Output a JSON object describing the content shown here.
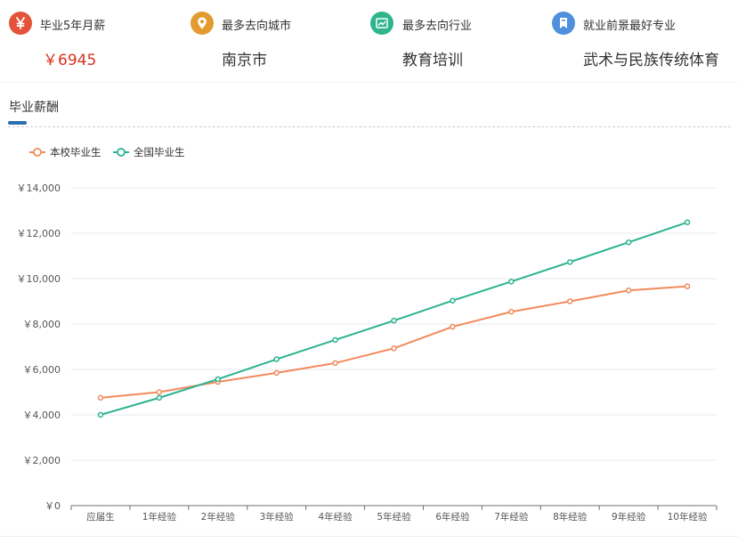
{
  "stats": [
    {
      "label": "毕业5年月薪",
      "value": "￥6945",
      "icon": "yen-icon",
      "color": "#e2533a",
      "value_color": "#d9331f"
    },
    {
      "label": "最多去向城市",
      "value": "南京市",
      "icon": "location-pin-icon",
      "color": "#e39a2f",
      "value_color": "#333333"
    },
    {
      "label": "最多去向行业",
      "value": "教育培训",
      "icon": "trend-chart-icon",
      "color": "#2fb58b",
      "value_color": "#333333"
    },
    {
      "label": "就业前景最好专业",
      "value": "武术与民族传统体育",
      "icon": "bookmark-icon",
      "color": "#4f8fdc",
      "value_color": "#333333"
    }
  ],
  "section": {
    "title": "毕业薪酬"
  },
  "chart_data": {
    "type": "line",
    "categories": [
      "应届生",
      "1年经验",
      "2年经验",
      "3年经验",
      "4年经验",
      "5年经验",
      "6年经验",
      "7年经验",
      "8年经验",
      "9年经验",
      "10年经验"
    ],
    "series": [
      {
        "name": "本校毕业生",
        "color": "#f28a5c",
        "values": [
          4750,
          5000,
          5450,
          5850,
          6280,
          6930,
          7880,
          8540,
          9000,
          9480,
          9660
        ]
      },
      {
        "name": "全国毕业生",
        "color": "#2bb38f",
        "values": [
          4000,
          4750,
          5570,
          6450,
          7300,
          8150,
          9030,
          9870,
          10730,
          11600,
          12480
        ]
      }
    ],
    "y_ticks": [
      "￥0",
      "￥2,000",
      "￥4,000",
      "￥6,000",
      "￥8,000",
      "￥10,000",
      "￥12,000",
      "￥14,000"
    ],
    "ylim": [
      0,
      14000
    ],
    "grid": true,
    "legend_position": "top-left"
  }
}
